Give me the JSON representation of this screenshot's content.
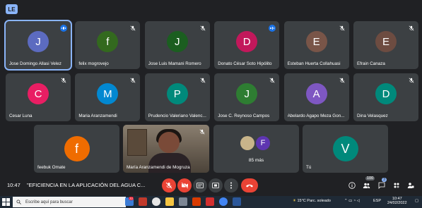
{
  "window_badge": "LE",
  "participants_row1": [
    {
      "name": "Jose Domingo Allasi Velez",
      "initial": "J",
      "color": "#5c6bc0",
      "state": "speaking",
      "active": true
    },
    {
      "name": "felix mogrovejo",
      "initial": "f",
      "color": "#33691e",
      "state": "muted"
    },
    {
      "name": "Jose Luis Mamani Romero",
      "initial": "J",
      "color": "#1b5e20",
      "state": "muted"
    },
    {
      "name": "Donato César Soto Hipólito",
      "initial": "D",
      "color": "#c2185b",
      "state": "speaking"
    },
    {
      "name": "Esteban Huerta Collahuasi",
      "initial": "E",
      "color": "#795548",
      "state": "muted"
    },
    {
      "name": "Efrain Canaza",
      "initial": "E",
      "color": "#6d4c41",
      "state": "muted"
    }
  ],
  "participants_row2": [
    {
      "name": "Cesar Luna",
      "initial": "C",
      "color": "#e91e63",
      "state": "muted"
    },
    {
      "name": "Maria Aranzamendi",
      "initial": "M",
      "color": "#0288d1",
      "state": "muted"
    },
    {
      "name": "Prudencio Valeriano Valenc...",
      "initial": "P",
      "color": "#00897b",
      "state": "muted"
    },
    {
      "name": "Jose C. Reynoso Campos",
      "initial": "J",
      "color": "#2e7d32",
      "state": "muted"
    },
    {
      "name": "Abelardo Agapo Meza Gon...",
      "initial": "A",
      "color": "#7e57c2",
      "state": "muted"
    },
    {
      "name": "Dina Velasquez",
      "initial": "D",
      "color": "#00897b",
      "state": "muted"
    }
  ],
  "participants_row3": {
    "feebuk": {
      "name": "feebuk Omate",
      "initial": "f",
      "color": "#ef6c00"
    },
    "video_tile": {
      "name": "María Aranzamendi de Mogruza"
    },
    "others": {
      "label": "85 más",
      "initial": "F",
      "color": "#5e35b1"
    },
    "self": {
      "name": "Tú",
      "initial": "V",
      "color": "#00897b"
    }
  },
  "bottom_bar": {
    "time": "10:47",
    "meeting_title": "\"EFICIENCIA EN LA APLICACIÓN DEL AGUA C...",
    "people_count": "100",
    "chat_count": "3"
  },
  "taskbar": {
    "search_placeholder": "Escribe aquí para buscar",
    "weather": "15°C Parc. soleado",
    "language": "ESP",
    "clock_time": "10:47",
    "clock_date": "24/02/2022",
    "notif_count": "32"
  },
  "colors": {
    "background": "#202124",
    "tile": "#3c4043",
    "accent": "#8ab4f8",
    "end_call": "#ea4335"
  }
}
